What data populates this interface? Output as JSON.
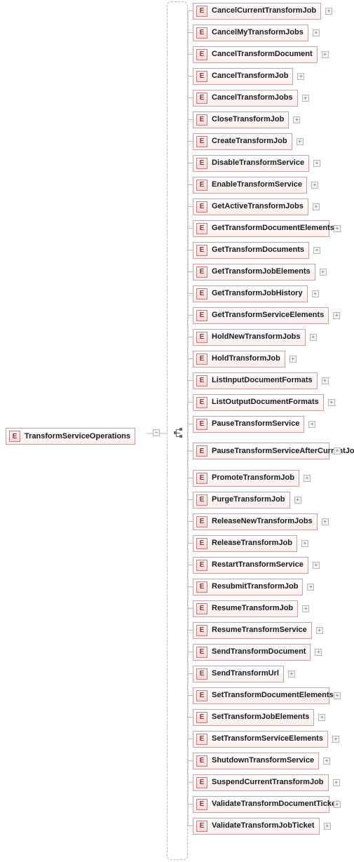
{
  "root": {
    "badge": "E",
    "label": "TransformServiceOperations"
  },
  "children": [
    {
      "badge": "E",
      "label": "CancelCurrentTransformJob"
    },
    {
      "badge": "E",
      "label": "CancelMyTransformJobs"
    },
    {
      "badge": "E",
      "label": "CancelTransformDocument"
    },
    {
      "badge": "E",
      "label": "CancelTransformJob"
    },
    {
      "badge": "E",
      "label": "CancelTransformJobs"
    },
    {
      "badge": "E",
      "label": "CloseTransformJob"
    },
    {
      "badge": "E",
      "label": "CreateTransformJob"
    },
    {
      "badge": "E",
      "label": "DisableTransformService"
    },
    {
      "badge": "E",
      "label": "EnableTransformService"
    },
    {
      "badge": "E",
      "label": "GetActiveTransformJobs"
    },
    {
      "badge": "E",
      "label": "GetTransformDocumentElements"
    },
    {
      "badge": "E",
      "label": "GetTransformDocuments"
    },
    {
      "badge": "E",
      "label": "GetTransformJobElements"
    },
    {
      "badge": "E",
      "label": "GetTransformJobHistory"
    },
    {
      "badge": "E",
      "label": "GetTransformServiceElements"
    },
    {
      "badge": "E",
      "label": "HoldNewTransformJobs"
    },
    {
      "badge": "E",
      "label": "HoldTransformJob"
    },
    {
      "badge": "E",
      "label": "ListInputDocumentFormats"
    },
    {
      "badge": "E",
      "label": "ListOutputDocumentFormats"
    },
    {
      "badge": "E",
      "label": "PauseTransformService"
    },
    {
      "badge": "E",
      "label": "PauseTransformServiceAfterCurrentJob",
      "wide": true
    },
    {
      "badge": "E",
      "label": "PromoteTransformJob"
    },
    {
      "badge": "E",
      "label": "PurgeTransformJob"
    },
    {
      "badge": "E",
      "label": "ReleaseNewTransformJobs"
    },
    {
      "badge": "E",
      "label": "ReleaseTransformJob"
    },
    {
      "badge": "E",
      "label": "RestartTransformService"
    },
    {
      "badge": "E",
      "label": "ResubmitTransformJob"
    },
    {
      "badge": "E",
      "label": "ResumeTransformJob"
    },
    {
      "badge": "E",
      "label": "ResumeTransformService"
    },
    {
      "badge": "E",
      "label": "SendTransformDocument"
    },
    {
      "badge": "E",
      "label": "SendTransformUrl"
    },
    {
      "badge": "E",
      "label": "SetTransformDocumentElements"
    },
    {
      "badge": "E",
      "label": "SetTransformJobElements"
    },
    {
      "badge": "E",
      "label": "SetTransformServiceElements"
    },
    {
      "badge": "E",
      "label": "ShutdownTransformService"
    },
    {
      "badge": "E",
      "label": "SuspendCurrentTransformJob"
    },
    {
      "badge": "E",
      "label": "ValidateTransformDocumentTicket"
    },
    {
      "badge": "E",
      "label": "ValidateTransformJobTicket"
    }
  ]
}
